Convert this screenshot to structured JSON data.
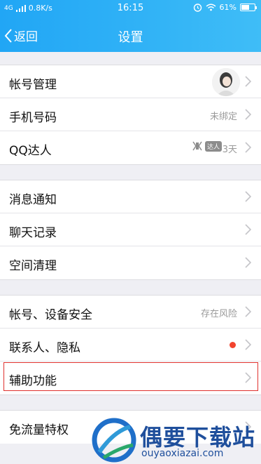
{
  "status_bar": {
    "network": "4G",
    "speed": "0.8K/s",
    "time": "16:15",
    "battery": "61%",
    "battery_level": 0.61
  },
  "nav": {
    "back_label": "返回",
    "title": "设置"
  },
  "groups": [
    {
      "rows": [
        {
          "label": "帐号管理",
          "value": ""
        },
        {
          "label": "手机号码",
          "value": "未绑定"
        },
        {
          "label": "QQ达人",
          "value": "3天",
          "tag": "达人"
        }
      ]
    },
    {
      "rows": [
        {
          "label": "消息通知"
        },
        {
          "label": "聊天记录"
        },
        {
          "label": "空间清理"
        }
      ]
    },
    {
      "rows": [
        {
          "label": "帐号、设备安全",
          "value": "存在风险"
        },
        {
          "label": "联系人、隐私"
        },
        {
          "label": "辅助功能"
        }
      ]
    },
    {
      "rows": [
        {
          "label": "免流量特权"
        }
      ]
    }
  ],
  "watermark": {
    "title": "偶要下载站",
    "url": "ouyaoxiazai.com"
  },
  "colors": {
    "header": "#2fb1f6",
    "red_dot": "#f2442e",
    "highlight_border": "#e0312e",
    "watermark": "#1f4f9c"
  },
  "icons": [
    "back-chevron-icon",
    "chevron-right-icon",
    "wifi-icon",
    "alarm-icon",
    "battery-icon",
    "signal-icon",
    "daren-icon"
  ]
}
